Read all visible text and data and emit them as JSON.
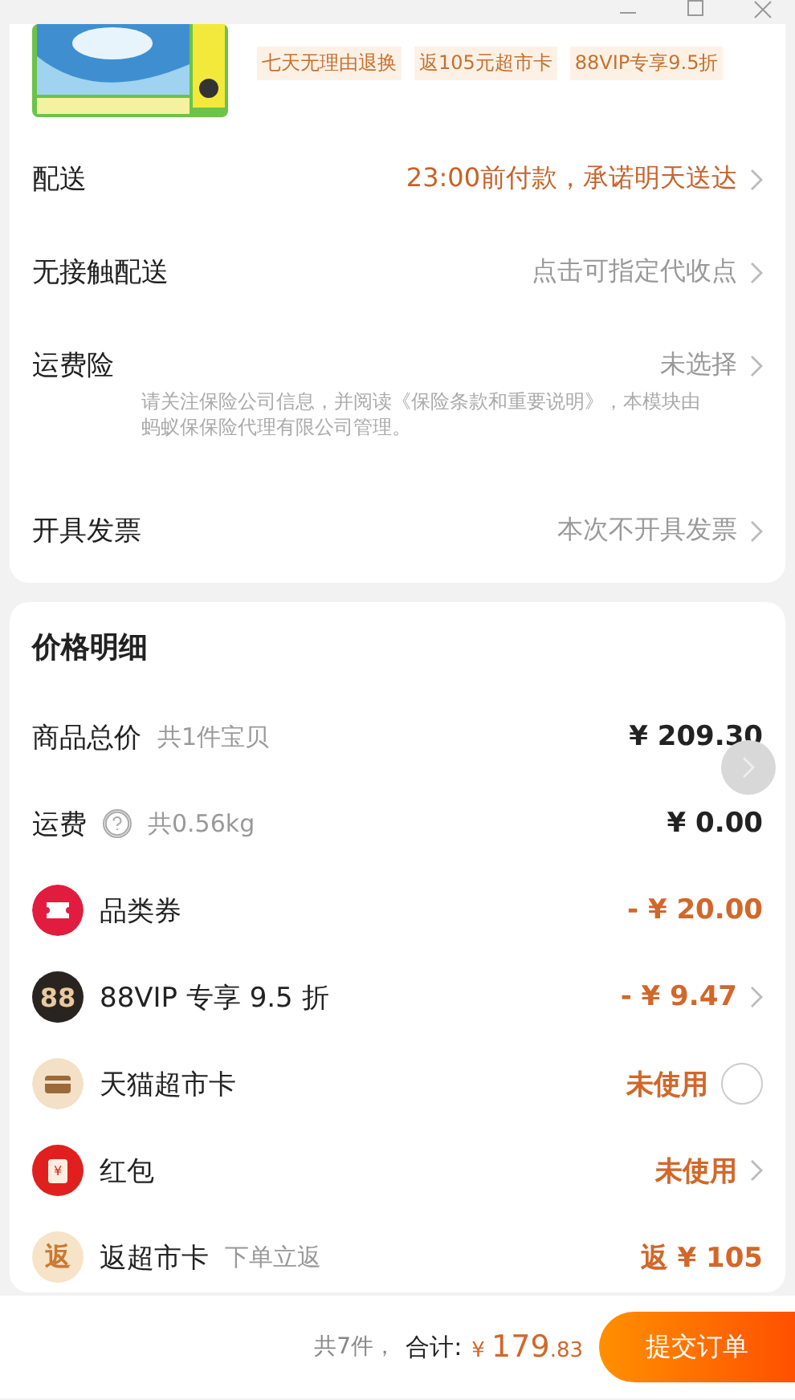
{
  "product": {
    "kind": "picture",
    "tags": [
      "七天无理由退换",
      "返105元超市卡",
      "88VIP专享9.5折"
    ]
  },
  "options": [
    {
      "label": "配送",
      "value": "23:00前付款，承诺明天送达",
      "highlight": true
    },
    {
      "label": "无接触配送",
      "value": "点击可指定代收点",
      "highlight": false
    },
    {
      "label": "运费险",
      "value": "未选择",
      "highlight": false,
      "note": "请关注保险公司信息，并阅读《保险条款和重要说明》，本模块由蚂蚁保保险代理有限公司管理。"
    },
    {
      "label": "开具发票",
      "value": "本次不开具发票",
      "highlight": false
    }
  ],
  "price_detail": {
    "title": "价格明细",
    "rows": [
      {
        "kind": "plain",
        "label": "商品总价",
        "sub": "共1件宝贝",
        "value": "¥ 209.30",
        "highlight": false
      },
      {
        "kind": "help",
        "label": "运费",
        "sub": "共0.56kg",
        "value": "¥ 0.00",
        "highlight": false
      },
      {
        "kind": "coupon",
        "label": "品类券",
        "value": "- ¥ 20.00",
        "highlight": true
      },
      {
        "kind": "vip",
        "badge": "88",
        "label": "88VIP 专享 9.5 折",
        "value": "- ¥ 9.47",
        "highlight": true,
        "chevron": true
      },
      {
        "kind": "card",
        "label": "天猫超市卡",
        "value": "未使用",
        "highlight": true,
        "checked": false
      },
      {
        "kind": "redpacket",
        "badge": "¥",
        "label": "红包",
        "value": "未使用",
        "highlight": true,
        "chevron": true
      },
      {
        "kind": "rebate",
        "badge": "返",
        "label": "返超市卡",
        "sub": "下单立返",
        "value": "返 ¥ 105",
        "highlight": true
      }
    ]
  },
  "footer": {
    "count": "共7件，",
    "total_label": "合计:",
    "currency": "¥",
    "total_int": "179",
    "total_dec": ".83",
    "submit": "提交订单"
  }
}
